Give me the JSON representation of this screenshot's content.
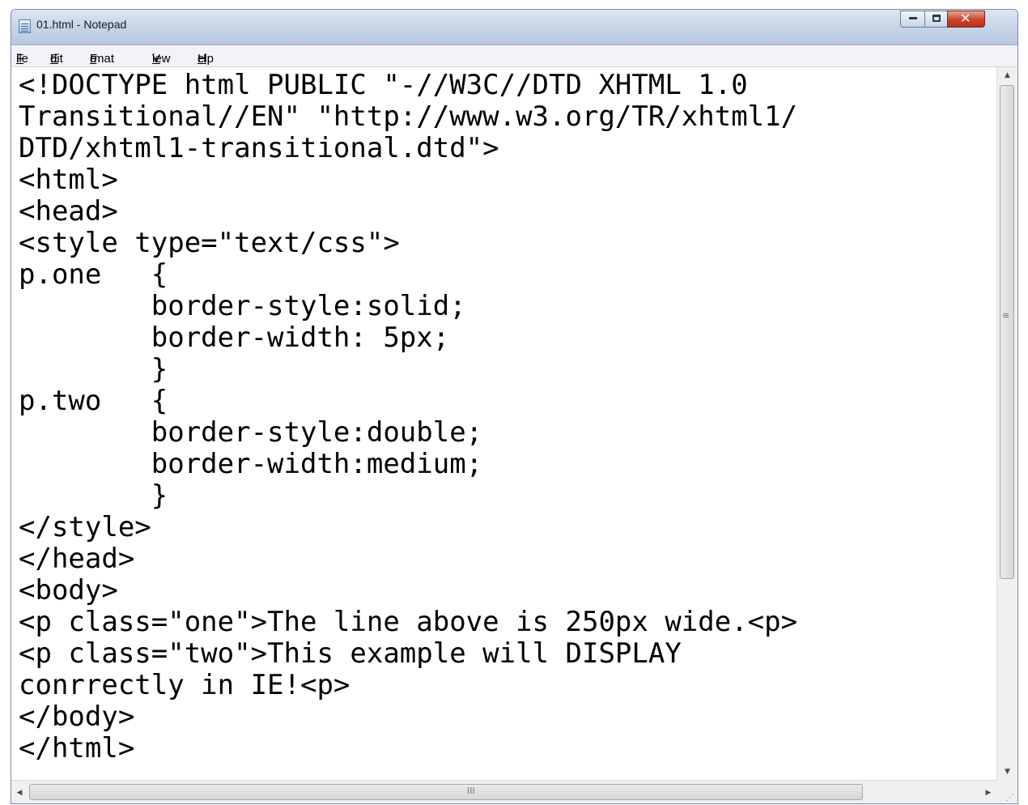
{
  "window": {
    "title": "01.html - Notepad",
    "controls": {
      "minimize_icon": "minimize-icon",
      "maximize_icon": "maximize-icon",
      "close_icon": "close-icon"
    }
  },
  "menubar": {
    "items": [
      {
        "pre": "",
        "u": "F",
        "post": "ile"
      },
      {
        "pre": "",
        "u": "E",
        "post": "dit"
      },
      {
        "pre": "F",
        "u": "o",
        "post": "rmat"
      },
      {
        "pre": "",
        "u": "V",
        "post": "iew"
      },
      {
        "pre": "",
        "u": "H",
        "post": "elp"
      }
    ]
  },
  "editor": {
    "content": "<!DOCTYPE html PUBLIC \"-//W3C//DTD XHTML 1.0\nTransitional//EN\" \"http://www.w3.org/TR/xhtml1/\nDTD/xhtml1-transitional.dtd\">\n<html>\n<head>\n<style type=\"text/css\">\np.one   {\n        border-style:solid;\n        border-width: 5px;\n        }\np.two   {\n        border-style:double;\n        border-width:medium;\n        }\n</style>\n</head>\n<body>\n<p class=\"one\">The line above is 250px wide.<p>\n<p class=\"two\">This example will DISPLAY\nconrrectly in IE!<p>\n</body>\n</html>"
  },
  "scrollbars": {
    "vertical": {
      "up_icon": "scroll-up-arrow-icon",
      "down_icon": "scroll-down-arrow-icon",
      "grip": "≡"
    },
    "horizontal": {
      "left_icon": "scroll-left-arrow-icon",
      "right_icon": "scroll-right-arrow-icon",
      "grip": "III"
    }
  }
}
